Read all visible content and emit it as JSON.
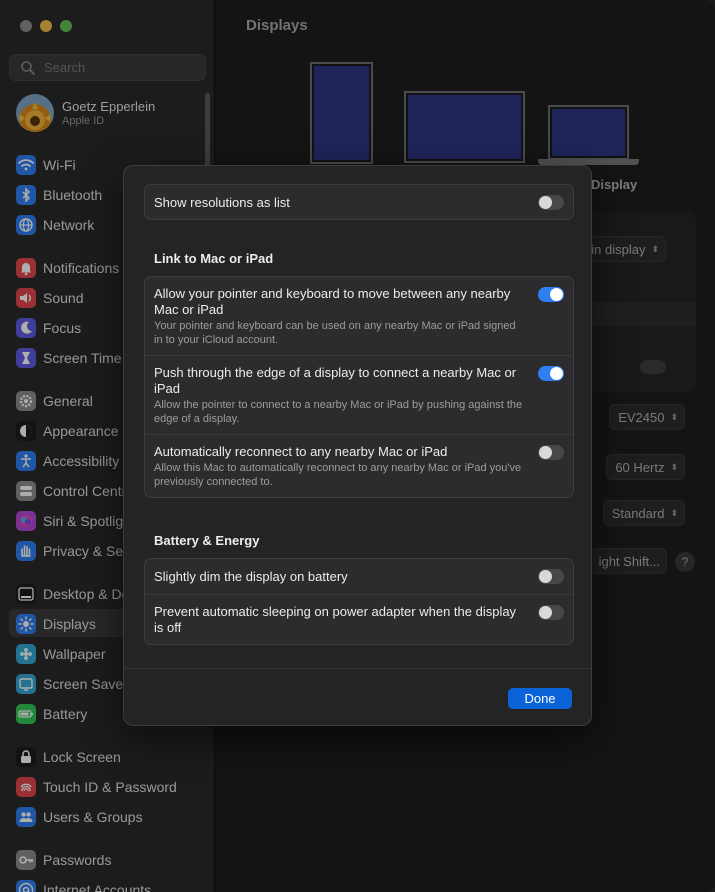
{
  "sidebar": {
    "search_placeholder": "Search",
    "profile": {
      "name": "Goetz Epperlein",
      "subtitle": "Apple ID"
    },
    "items": [
      {
        "label": "Wi-Fi",
        "icon": "wifi-icon",
        "color": "#2f7ff3"
      },
      {
        "label": "Bluetooth",
        "icon": "bluetooth-icon",
        "color": "#2f7ff3"
      },
      {
        "label": "Network",
        "icon": "globe-icon",
        "color": "#2f7ff3"
      },
      {
        "label": "Notifications",
        "icon": "bell-icon",
        "color": "#e5484d"
      },
      {
        "label": "Sound",
        "icon": "speaker-icon",
        "color": "#e5484d"
      },
      {
        "label": "Focus",
        "icon": "moon-icon",
        "color": "#5e5ce6"
      },
      {
        "label": "Screen Time",
        "icon": "hourglass-icon",
        "color": "#5e5ce6"
      },
      {
        "label": "General",
        "icon": "gear-icon",
        "color": "#8e8e93"
      },
      {
        "label": "Appearance",
        "icon": "appearance-icon",
        "color": "#1c1c1e"
      },
      {
        "label": "Accessibility",
        "icon": "accessibility-icon",
        "color": "#2f7ff3"
      },
      {
        "label": "Control Centre",
        "icon": "control-centre-icon",
        "color": "#8e8e93"
      },
      {
        "label": "Siri & Spotlight",
        "icon": "siri-icon",
        "color": "#b44bd8"
      },
      {
        "label": "Privacy & Security",
        "icon": "hand-icon",
        "color": "#2f7ff3"
      },
      {
        "label": "Desktop & Dock",
        "icon": "dock-icon",
        "color": "#1c1c1e"
      },
      {
        "label": "Displays",
        "icon": "sun-icon",
        "color": "#2f7ff3"
      },
      {
        "label": "Wallpaper",
        "icon": "flower-icon",
        "color": "#35a8d8"
      },
      {
        "label": "Screen Saver",
        "icon": "screen-saver-icon",
        "color": "#35a8d8"
      },
      {
        "label": "Battery",
        "icon": "battery-icon",
        "color": "#34c759"
      },
      {
        "label": "Lock Screen",
        "icon": "lock-icon",
        "color": "#1c1c1e"
      },
      {
        "label": "Touch ID & Password",
        "icon": "fingerprint-icon",
        "color": "#e5484d"
      },
      {
        "label": "Users & Groups",
        "icon": "users-icon",
        "color": "#2f7ff3"
      },
      {
        "label": "Passwords",
        "icon": "key-icon",
        "color": "#8e8e93"
      },
      {
        "label": "Internet Accounts",
        "icon": "at-icon",
        "color": "#2f7ff3"
      }
    ],
    "selected": "Displays"
  },
  "main": {
    "title": "Displays",
    "display_label": "Display",
    "background_values": {
      "use_as": "Main display",
      "display_model": "EV2450",
      "refresh_rate": "60 Hertz",
      "color_profile": "Standard",
      "night_shift": "ight Shift..."
    }
  },
  "sheet": {
    "show_resolutions": {
      "label": "Show resolutions as list",
      "on": false
    },
    "link_section": "Link to Mac or iPad",
    "link_rows": [
      {
        "title": "Allow your pointer and keyboard to move between any nearby Mac or iPad",
        "desc": "Your pointer and keyboard can be used on any nearby Mac or iPad signed in to your iCloud account.",
        "on": true
      },
      {
        "title": "Push through the edge of a display to connect a nearby Mac or iPad",
        "desc": "Allow the pointer to connect to a nearby Mac or iPad by pushing against the edge of a display.",
        "on": true
      },
      {
        "title": "Automatically reconnect to any nearby Mac or iPad",
        "desc": "Allow this Mac to automatically reconnect to any nearby Mac or iPad you've previously connected to.",
        "on": false
      }
    ],
    "battery_section": "Battery & Energy",
    "battery_rows": [
      {
        "title": "Slightly dim the display on battery",
        "on": false
      },
      {
        "title": "Prevent automatic sleeping on power adapter when the display is off",
        "on": false
      }
    ],
    "done_label": "Done"
  },
  "colors": {
    "accent": "#2f7ff3",
    "done_button": "#0a64d8"
  }
}
